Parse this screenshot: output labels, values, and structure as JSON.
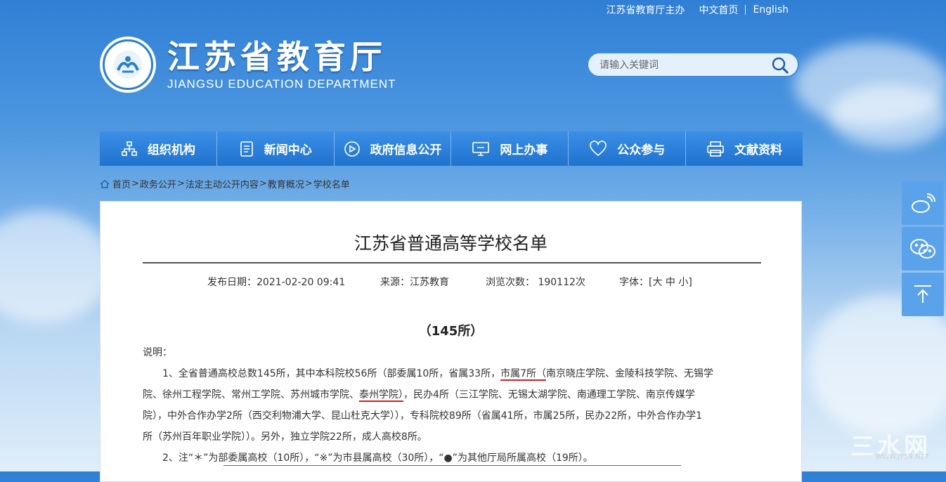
{
  "topbar": {
    "sponsor": "江苏省教育厅主办",
    "cn_home": "中文首页",
    "english": "English"
  },
  "brand": {
    "cn": "江苏省教育厅",
    "en": "JIANGSU EDUCATION DEPARTMENT"
  },
  "search": {
    "placeholder": "请输入关键词"
  },
  "nav": [
    {
      "label": "组织机构",
      "icon": "org-chart-icon"
    },
    {
      "label": "新闻中心",
      "icon": "document-icon"
    },
    {
      "label": "政府信息公开",
      "icon": "compass-icon"
    },
    {
      "label": "网上办事",
      "icon": "monitor-icon"
    },
    {
      "label": "公众参与",
      "icon": "heart-icon"
    },
    {
      "label": "文献资料",
      "icon": "printer-icon"
    }
  ],
  "breadcrumb": [
    "首页",
    "政务公开",
    "法定主动公开内容",
    "教育概况",
    "学校名单"
  ],
  "article": {
    "title": "江苏省普通高等学校名单",
    "publish": "发布日期：2021-02-20 09:41",
    "source": "来源：江苏教育",
    "views": "浏览次数：  190112次",
    "font": "字体：[大 中 小]",
    "count": "（145所）",
    "intro": "说明：",
    "p1a": "1、全省普通高校总数145所，其中本科院校56所（部委属10所，省属33所，",
    "p1b": "市属7所（",
    "p1c": "南京晓庄学院、金陵科技学院、无锡学",
    "p2a": "院、徐州工程学院、常州工学院、苏州城市学院、",
    "p2b": "泰州学院）",
    "p2c": "，民办4所（三江学院、无锡太湖学院、南通理工学院、南京传媒学",
    "p3": "院），中外合作办学2所（西交利物浦大学、昆山杜克大学）），专科院校89所（省属41所，市属25所，民办22所，中外合作办学1",
    "p4": "所（苏州百年职业学院））。另外，独立学院22所，成人高校8所。",
    "p5": "2、注“＊”为部委属高校（10所），“※”为市县属高校（30所），“●”为其他厅局所属高校（19所）。"
  },
  "watermark": {
    "main": "三水网",
    "sub": "WWW.JY59.NET"
  },
  "colors": {
    "nav": "#1f73cf",
    "accent_red": "#d21e1e",
    "side": "#5aa3ea"
  }
}
